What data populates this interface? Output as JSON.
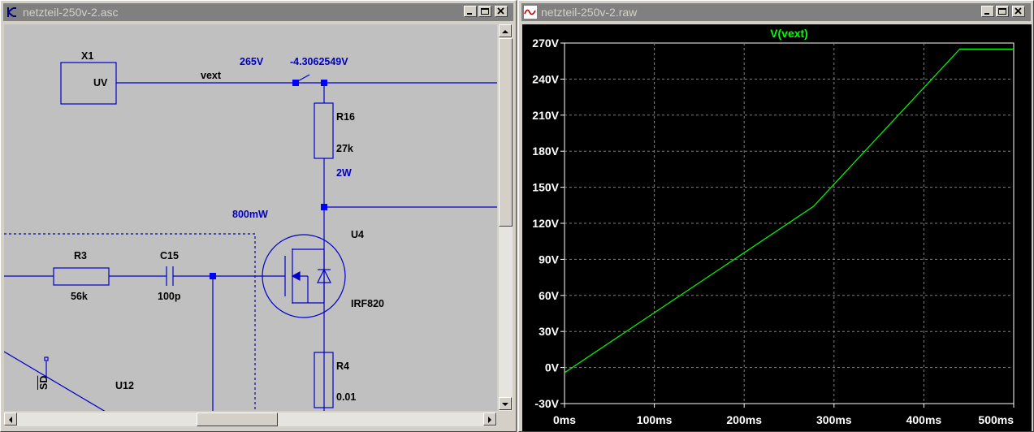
{
  "schematic_window": {
    "title": "netzteil-250v-2.asc",
    "labels": {
      "x1": "X1",
      "uv": "UV",
      "vext": "vext",
      "v265": "265V",
      "vneg": "-4.3062549V",
      "r16": "R16",
      "r16_val": "27k",
      "p2w": "2W",
      "p800": "800mW",
      "u4": "U4",
      "irf": "IRF820",
      "r3": "R3",
      "r3_val": "56k",
      "c15": "C15",
      "c15_val": "100p",
      "r4": "R4",
      "r4_val": "0.01",
      "u12": "U12",
      "sd": "SD"
    }
  },
  "plot_window": {
    "title": "netzteil-250v-2.raw",
    "colors": {
      "trace": "#00ff00",
      "background": "#000000",
      "axis_text": "#ffffff",
      "grid": "#808080"
    }
  },
  "chart_data": {
    "type": "line",
    "title": "V(vext)",
    "xlabel": "",
    "ylabel": "",
    "x_ticks": [
      "0ms",
      "100ms",
      "200ms",
      "300ms",
      "400ms",
      "500ms"
    ],
    "y_ticks": [
      "-30V",
      "0V",
      "30V",
      "60V",
      "90V",
      "120V",
      "150V",
      "180V",
      "210V",
      "240V",
      "270V"
    ],
    "xlim": [
      0,
      500
    ],
    "ylim": [
      -30,
      270
    ],
    "grid": true,
    "series": [
      {
        "name": "V(vext)",
        "x": [
          0,
          277,
          440,
          500
        ],
        "y": [
          -4.3,
          134,
          265,
          265
        ]
      }
    ]
  }
}
